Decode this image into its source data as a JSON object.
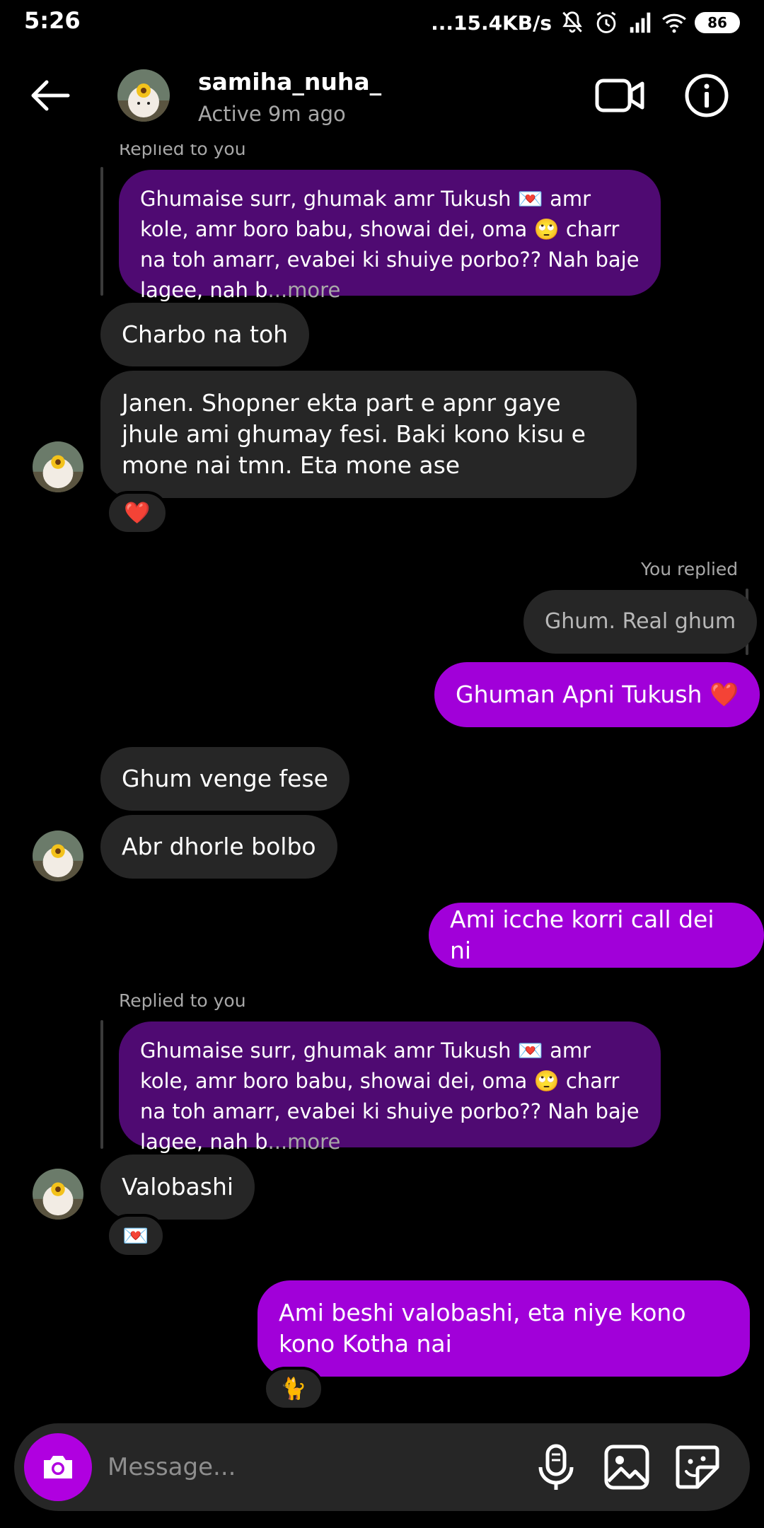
{
  "status_bar": {
    "time": "5:26",
    "network_speed": "...15.4KB/s",
    "battery": "86",
    "icons": [
      "mute-icon",
      "alarm-icon",
      "signal-icon",
      "wifi-icon",
      "battery-icon"
    ]
  },
  "header": {
    "name": "samiha_nuha_",
    "status": "Active 9m ago"
  },
  "messages": {
    "top_reply_label": "Replied to you",
    "quote_1": "Ghumaise surr, ghumak amr Tukush 💌 amr kole, amr boro babu, showai dei, oma 🙄 charr na toh amarr, evabei ki shuiye porbo?? Nah baje lagee, nah b",
    "more_label": "...more",
    "m1": "Charbo na toh",
    "m2": "Janen. Shopner ekta part e apnr gaye jhule ami ghumay fesi. Baki kono kisu e mone nai tmn. Eta mone ase",
    "m2_reaction": "❤️",
    "you_replied_label": "You replied",
    "quote_2": "Ghum. Real ghum",
    "m3": "Ghuman Apni Tukush ❤️",
    "m4": "Ghum venge fese",
    "m5": "Abr dhorle bolbo",
    "m6": "Ami icche korri call dei ni",
    "reply_label_2": "Replied to you",
    "quote_3": "Ghumaise surr, ghumak amr Tukush 💌 amr kole, amr boro babu, showai dei, oma 🙄 charr na toh amarr, evabei ki shuiye porbo?? Nah baje lagee, nah b",
    "m7": "Valobashi",
    "m7_reaction": "💌",
    "m8": "Ami beshi valobashi, eta niye kono kono Kotha nai",
    "m8_reaction": "🐈"
  },
  "composer": {
    "placeholder": "Message..."
  },
  "colors": {
    "background": "#000000",
    "incoming_bubble": "#262626",
    "outgoing_bubble": "#a100d9",
    "quoted_bubble": "#4f0a72",
    "camera_button": "#b000e0"
  }
}
